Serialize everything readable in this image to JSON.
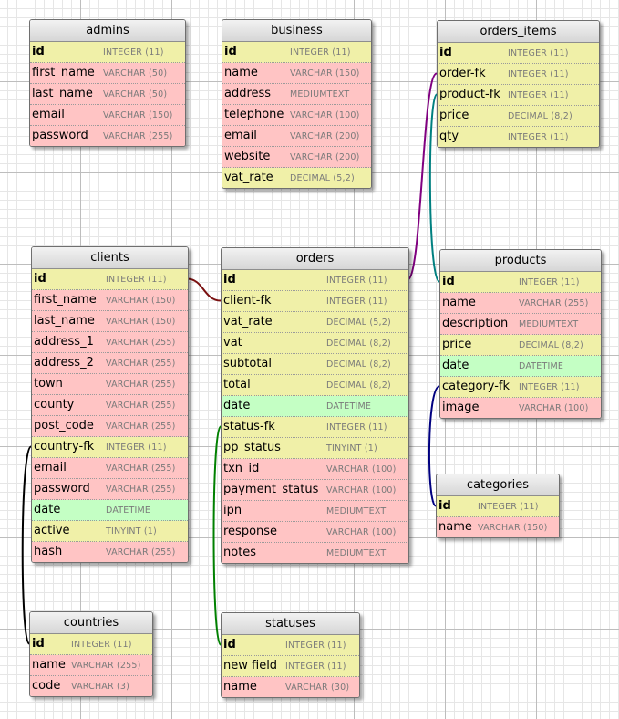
{
  "tables": [
    {
      "name": "admins",
      "fields": [
        {
          "name": "id",
          "type": "INTEGER (11)",
          "kind": "pk"
        },
        {
          "name": "first_name",
          "type": "VARCHAR (50)",
          "kind": "col"
        },
        {
          "name": "last_name",
          "type": "VARCHAR (50)",
          "kind": "col"
        },
        {
          "name": "email",
          "type": "VARCHAR (150)",
          "kind": "col"
        },
        {
          "name": "password",
          "type": "VARCHAR (255)",
          "kind": "col"
        }
      ]
    },
    {
      "name": "business",
      "fields": [
        {
          "name": "id",
          "type": "INTEGER (11)",
          "kind": "pk"
        },
        {
          "name": "name",
          "type": "VARCHAR (150)",
          "kind": "col"
        },
        {
          "name": "address",
          "type": "MEDIUMTEXT",
          "kind": "col"
        },
        {
          "name": "telephone",
          "type": "VARCHAR (100)",
          "kind": "col"
        },
        {
          "name": "email",
          "type": "VARCHAR (200)",
          "kind": "col"
        },
        {
          "name": "website",
          "type": "VARCHAR (200)",
          "kind": "col"
        },
        {
          "name": "vat_rate",
          "type": "DECIMAL (5,2)",
          "kind": "fk"
        }
      ]
    },
    {
      "name": "orders_items",
      "fields": [
        {
          "name": "id",
          "type": "INTEGER (11)",
          "kind": "pk"
        },
        {
          "name": "order-fk",
          "type": "INTEGER (11)",
          "kind": "fk"
        },
        {
          "name": "product-fk",
          "type": "INTEGER (11)",
          "kind": "fk"
        },
        {
          "name": "price",
          "type": "DECIMAL (8,2)",
          "kind": "fk"
        },
        {
          "name": "qty",
          "type": "INTEGER (11)",
          "kind": "fk"
        }
      ]
    },
    {
      "name": "clients",
      "fields": [
        {
          "name": "id",
          "type": "INTEGER (11)",
          "kind": "pk"
        },
        {
          "name": "first_name",
          "type": "VARCHAR (150)",
          "kind": "col"
        },
        {
          "name": "last_name",
          "type": "VARCHAR (150)",
          "kind": "col"
        },
        {
          "name": "address_1",
          "type": "VARCHAR (255)",
          "kind": "col"
        },
        {
          "name": "address_2",
          "type": "VARCHAR (255)",
          "kind": "col"
        },
        {
          "name": "town",
          "type": "VARCHAR (255)",
          "kind": "col"
        },
        {
          "name": "county",
          "type": "VARCHAR (255)",
          "kind": "col"
        },
        {
          "name": "post_code",
          "type": "VARCHAR (255)",
          "kind": "col"
        },
        {
          "name": "country-fk",
          "type": "INTEGER (11)",
          "kind": "fk"
        },
        {
          "name": "email",
          "type": "VARCHAR (255)",
          "kind": "col"
        },
        {
          "name": "password",
          "type": "VARCHAR (255)",
          "kind": "col"
        },
        {
          "name": "date",
          "type": "DATETIME",
          "kind": "dt"
        },
        {
          "name": "active",
          "type": "TINYINT (1)",
          "kind": "fk"
        },
        {
          "name": "hash",
          "type": "VARCHAR (255)",
          "kind": "col"
        }
      ]
    },
    {
      "name": "orders",
      "fields": [
        {
          "name": "id",
          "type": "INTEGER (11)",
          "kind": "pk"
        },
        {
          "name": "client-fk",
          "type": "INTEGER (11)",
          "kind": "fk"
        },
        {
          "name": "vat_rate",
          "type": "DECIMAL (5,2)",
          "kind": "fk"
        },
        {
          "name": "vat",
          "type": "DECIMAL (8,2)",
          "kind": "fk"
        },
        {
          "name": "subtotal",
          "type": "DECIMAL (8,2)",
          "kind": "fk"
        },
        {
          "name": "total",
          "type": "DECIMAL (8,2)",
          "kind": "fk"
        },
        {
          "name": "date",
          "type": "DATETIME",
          "kind": "dt"
        },
        {
          "name": "status-fk",
          "type": "INTEGER (11)",
          "kind": "fk"
        },
        {
          "name": "pp_status",
          "type": "TINYINT (1)",
          "kind": "fk"
        },
        {
          "name": "txn_id",
          "type": "VARCHAR (100)",
          "kind": "col"
        },
        {
          "name": "payment_status",
          "type": "VARCHAR (100)",
          "kind": "col"
        },
        {
          "name": "ipn",
          "type": "MEDIUMTEXT",
          "kind": "col"
        },
        {
          "name": "response",
          "type": "VARCHAR (100)",
          "kind": "col"
        },
        {
          "name": "notes",
          "type": "MEDIUMTEXT",
          "kind": "col"
        }
      ]
    },
    {
      "name": "products",
      "fields": [
        {
          "name": "id",
          "type": "INTEGER (11)",
          "kind": "pk"
        },
        {
          "name": "name",
          "type": "VARCHAR (255)",
          "kind": "col"
        },
        {
          "name": "description",
          "type": "MEDIUMTEXT",
          "kind": "col"
        },
        {
          "name": "price",
          "type": "DECIMAL (8,2)",
          "kind": "fk"
        },
        {
          "name": "date",
          "type": "DATETIME",
          "kind": "dt"
        },
        {
          "name": "category-fk",
          "type": "INTEGER (11)",
          "kind": "fk"
        },
        {
          "name": "image",
          "type": "VARCHAR (100)",
          "kind": "col"
        }
      ]
    },
    {
      "name": "categories",
      "fields": [
        {
          "name": "id",
          "type": "INTEGER (11)",
          "kind": "pk"
        },
        {
          "name": "name",
          "type": "VARCHAR (150)",
          "kind": "col"
        }
      ]
    },
    {
      "name": "countries",
      "fields": [
        {
          "name": "id",
          "type": "INTEGER (11)",
          "kind": "pk"
        },
        {
          "name": "name",
          "type": "VARCHAR (255)",
          "kind": "col"
        },
        {
          "name": "code",
          "type": "VARCHAR (3)",
          "kind": "col"
        }
      ]
    },
    {
      "name": "statuses",
      "fields": [
        {
          "name": "id",
          "type": "INTEGER (11)",
          "kind": "pk"
        },
        {
          "name": "new field",
          "type": "INTEGER (11)",
          "kind": "fk"
        },
        {
          "name": "name",
          "type": "VARCHAR (30)",
          "kind": "col"
        }
      ]
    }
  ],
  "relations": [
    {
      "from": "clients.id",
      "to": "orders.client-fk",
      "color": "#7a1010"
    },
    {
      "from": "orders.id",
      "to": "orders_items.order-fk",
      "color": "#800080"
    },
    {
      "from": "products.id",
      "to": "orders_items.product-fk",
      "color": "#008080"
    },
    {
      "from": "categories.id",
      "to": "products.category-fk",
      "color": "#000080"
    },
    {
      "from": "countries.id",
      "to": "clients.country-fk",
      "color": "#000000"
    },
    {
      "from": "statuses.id",
      "to": "orders.status-fk",
      "color": "#008000"
    }
  ]
}
